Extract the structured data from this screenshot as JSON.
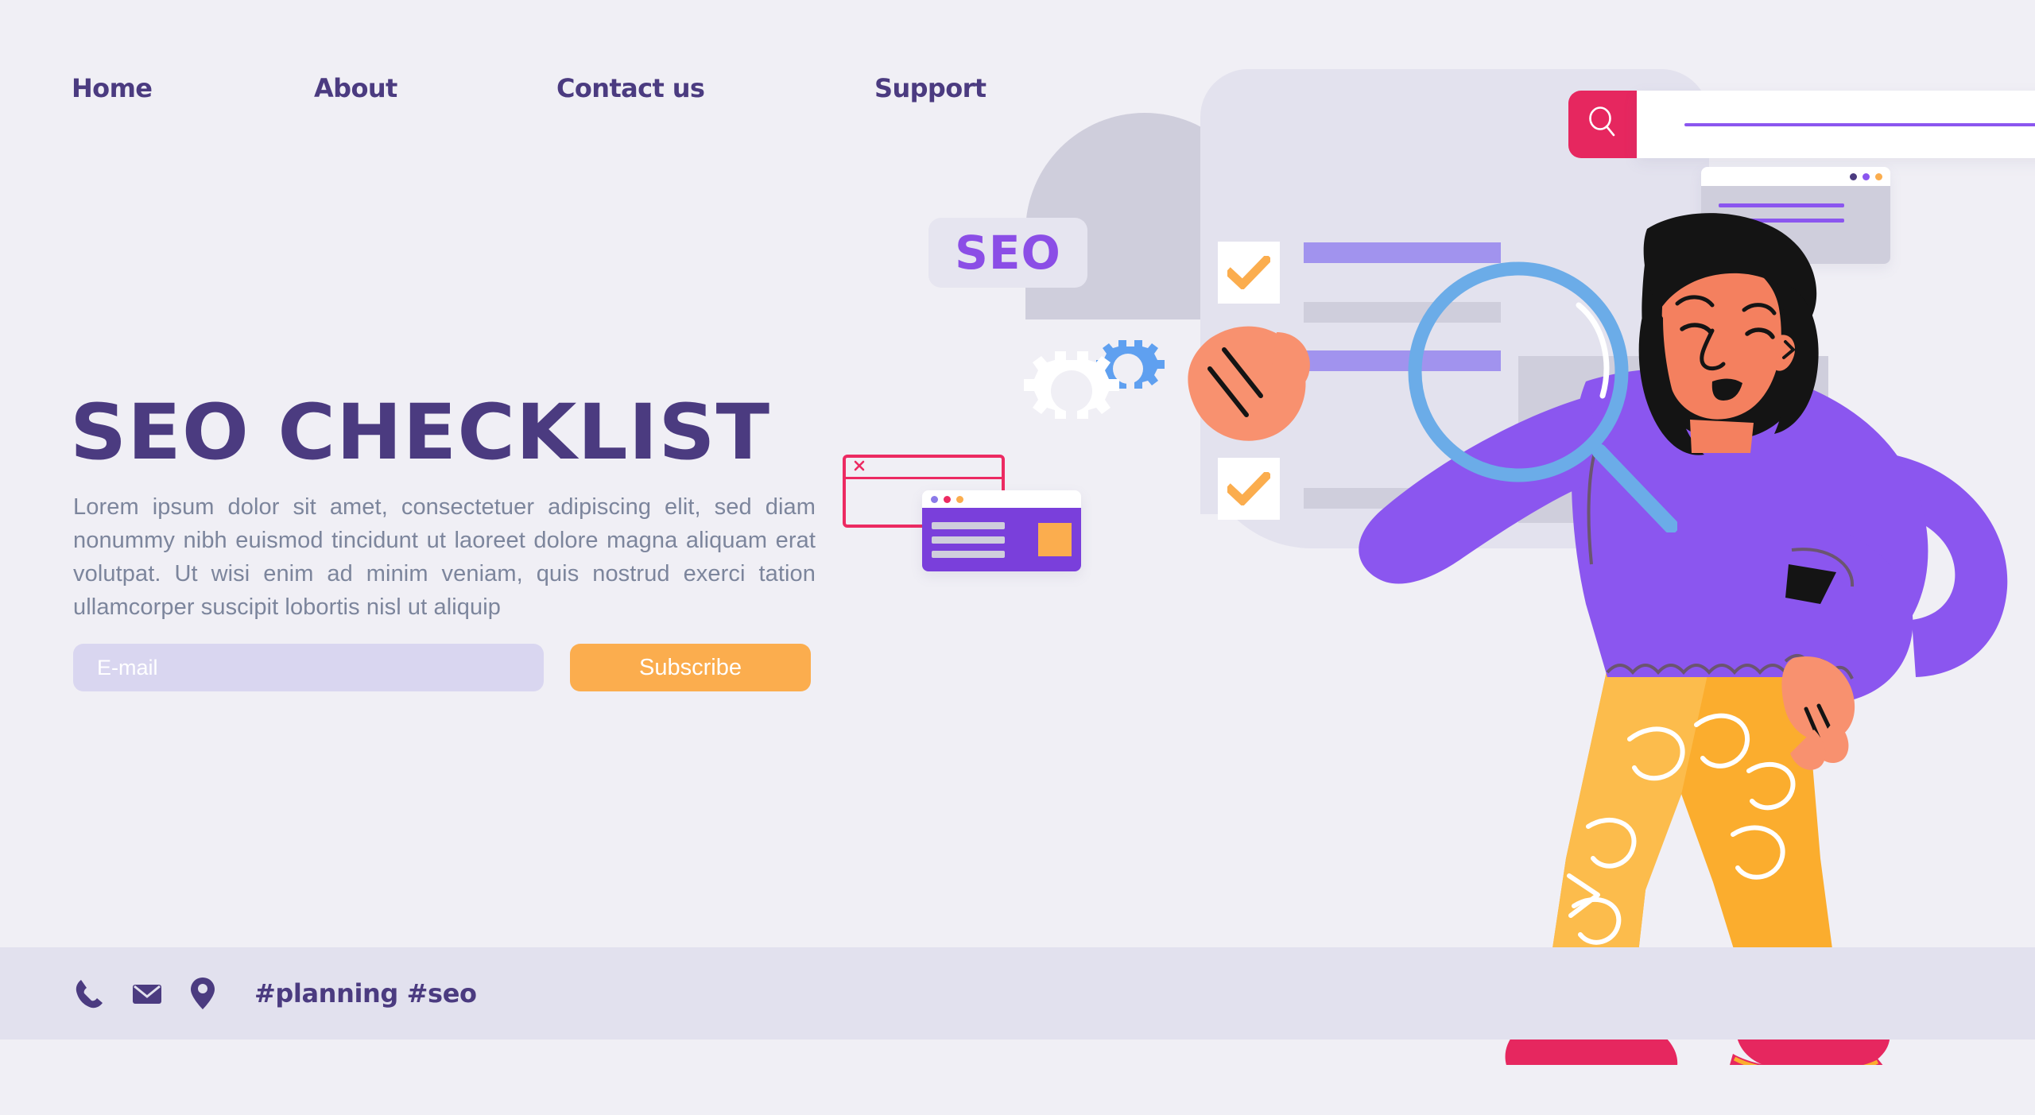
{
  "theme": {
    "background": "#f0eff5",
    "footer_background": "#e2e1ee",
    "primary_purple": "#4b3b80",
    "accent_purple": "#8b4ee6",
    "bar_purple": "#a193ee",
    "accent_orange": "#fbad4e",
    "accent_pink": "#e6275f",
    "accent_blue": "#6bace8",
    "body_text": "#7c859c",
    "paper_light": "#e3e2ee",
    "paper_dark": "#cfcedc"
  },
  "nav": {
    "items": [
      {
        "label": "Home"
      },
      {
        "label": "About"
      },
      {
        "label": "Contact us"
      },
      {
        "label": "Support"
      }
    ]
  },
  "hero": {
    "title": "SEO CHECKLIST",
    "paragraph": "Lorem ipsum dolor sit amet, consectetuer adipiscing elit, sed diam nonummy nibh euismod tincidunt ut laoreet dolore magna aliquam erat volutpat. Ut wisi enim ad minim veniam, quis nostrud exerci tation ullamcorper suscipit lobortis nisl ut aliquip"
  },
  "subscribe_form": {
    "email_placeholder": "E-mail",
    "email_value": "",
    "button_label": "Subscribe"
  },
  "footer": {
    "icons": [
      {
        "name": "phone-icon"
      },
      {
        "name": "envelope-icon"
      },
      {
        "name": "location-pin-icon"
      }
    ],
    "tags": "#planning #seo"
  },
  "illustration": {
    "seo_badge": {
      "label": "SEO"
    },
    "search_bar": {
      "icon": "search-icon",
      "query_value": ""
    },
    "checklist": {
      "items": [
        {
          "checked": true,
          "icon": "checkmark-icon",
          "bars": [
            "purple",
            "grey"
          ]
        },
        {
          "checked": true,
          "icon": "checkmark-icon",
          "bars": [
            "purple"
          ]
        },
        {
          "checked": true,
          "icon": "checkmark-icon",
          "bars": [
            "grey"
          ]
        }
      ]
    },
    "mini_browser_window": {
      "dots": [
        "#4b3b80",
        "#8b56ef",
        "#fbad4e"
      ],
      "lines": 2
    },
    "pink_window": {
      "icon": "close-x-icon"
    },
    "purple_window": {
      "dots": [
        "#8b7ae8",
        "#ec2a62",
        "#fbad4e"
      ],
      "lines": 3,
      "thumbnail": "orange-square"
    },
    "gears": [
      {
        "name": "large-gear-icon",
        "color": "#ffffff"
      },
      {
        "name": "small-gear-icon",
        "color": "#5fa0f0"
      }
    ],
    "magnifier": {
      "name": "magnifying-glass-icon",
      "color": "#6bace8"
    },
    "character": {
      "name": "woman-with-magnifier",
      "hair": "#141414",
      "skin": "#f47e5f",
      "sweater": "#8b56ef",
      "pants": "#fbad2e",
      "shoes": "#e6275f"
    }
  }
}
